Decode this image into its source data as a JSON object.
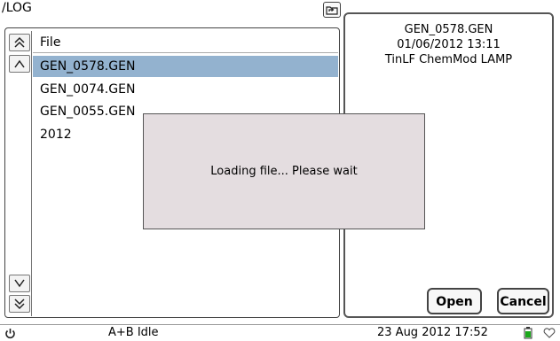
{
  "path": "/LOG",
  "file_list": {
    "header": "File",
    "rows": [
      {
        "name": "GEN_0578.GEN",
        "selected": true
      },
      {
        "name": "GEN_0074.GEN",
        "selected": false
      },
      {
        "name": "GEN_0055.GEN",
        "selected": false
      },
      {
        "name": "2012",
        "selected": false
      }
    ]
  },
  "info_panel": {
    "line1": "GEN_0578.GEN",
    "line2": "01/06/2012 13:11",
    "line3": "TinLF ChemMod LAMP"
  },
  "buttons": {
    "open": "Open",
    "cancel": "Cancel"
  },
  "dialog": {
    "message": "Loading file... Please wait"
  },
  "status_bar": {
    "state": "A+B Idle",
    "datetime": "23 Aug 2012 17:52"
  },
  "colors": {
    "selection": "#93b2cf",
    "dialog_bg": "#e4dde0",
    "battery": "#1aa81a"
  },
  "icons": {
    "up_folder": "folder-up-icon",
    "power": "power-icon",
    "battery": "battery-icon",
    "connection": "heart-icon"
  }
}
